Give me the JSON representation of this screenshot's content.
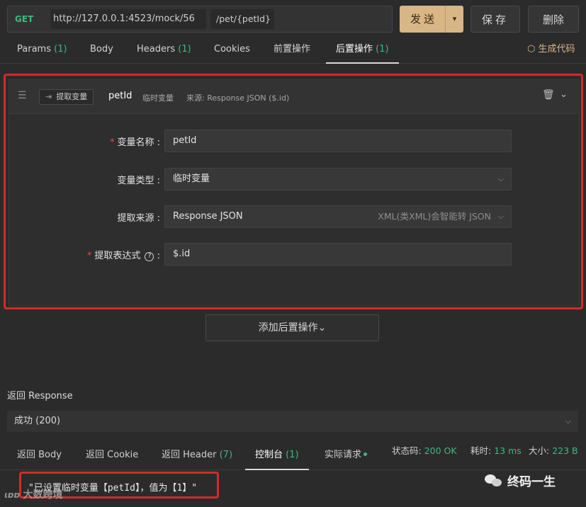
{
  "request": {
    "method": "GET",
    "url": "http://127.0.0.1:4523/mock/56",
    "path": "/pet/{petId}",
    "send_label": "发送",
    "save_label": "保存",
    "delete_label": "删除"
  },
  "tabs": [
    {
      "label": "Params",
      "count": "(1)"
    },
    {
      "label": "Body",
      "count": ""
    },
    {
      "label": "Headers",
      "count": "(1)"
    },
    {
      "label": "Cookies",
      "count": ""
    },
    {
      "label": "前置操作",
      "count": ""
    },
    {
      "label": "后置操作",
      "count": "(1)",
      "active": true
    }
  ],
  "generate_code_label": "生成代码",
  "post_op": {
    "tag_label": "提取变量",
    "name": "petId",
    "type": "临时变量",
    "source": "来源: Response JSON ($.id)",
    "fields": {
      "var_name_label": "变量名称",
      "var_name_value": "petId",
      "var_type_label": "变量类型",
      "var_type_value": "临时变量",
      "source_label": "提取来源",
      "source_value": "Response JSON",
      "source_hint": "XML(类XML)会智能转 JSON",
      "expr_label": "提取表达式",
      "expr_value": "$.id"
    }
  },
  "add_post_op_label": "添加后置操作",
  "response": {
    "title": "返回 Response",
    "status_select": "成功 (200)",
    "tabs": [
      {
        "label": "返回 Body",
        "count": ""
      },
      {
        "label": "返回 Cookie",
        "count": ""
      },
      {
        "label": "返回 Header",
        "count": "(7)"
      },
      {
        "label": "控制台",
        "count": "(1)",
        "active": true
      },
      {
        "label": "实际请求",
        "count": ""
      }
    ],
    "status_code_label": "状态码:",
    "status_code_value": "200 OK",
    "time_label": "耗时:",
    "time_value": "13 ms",
    "size_label": "大小:",
    "size_value": "223 B",
    "console_line": "\"已设置临时变量【petId】，值为【1】\""
  },
  "watermarks": {
    "left": "大数跨境",
    "right": "终码一生"
  },
  "colors": {
    "accent_green": "#3fb882",
    "send_button": "#d8b686",
    "highlight_red": "#d42a2a",
    "background": "#2b2b2b"
  }
}
